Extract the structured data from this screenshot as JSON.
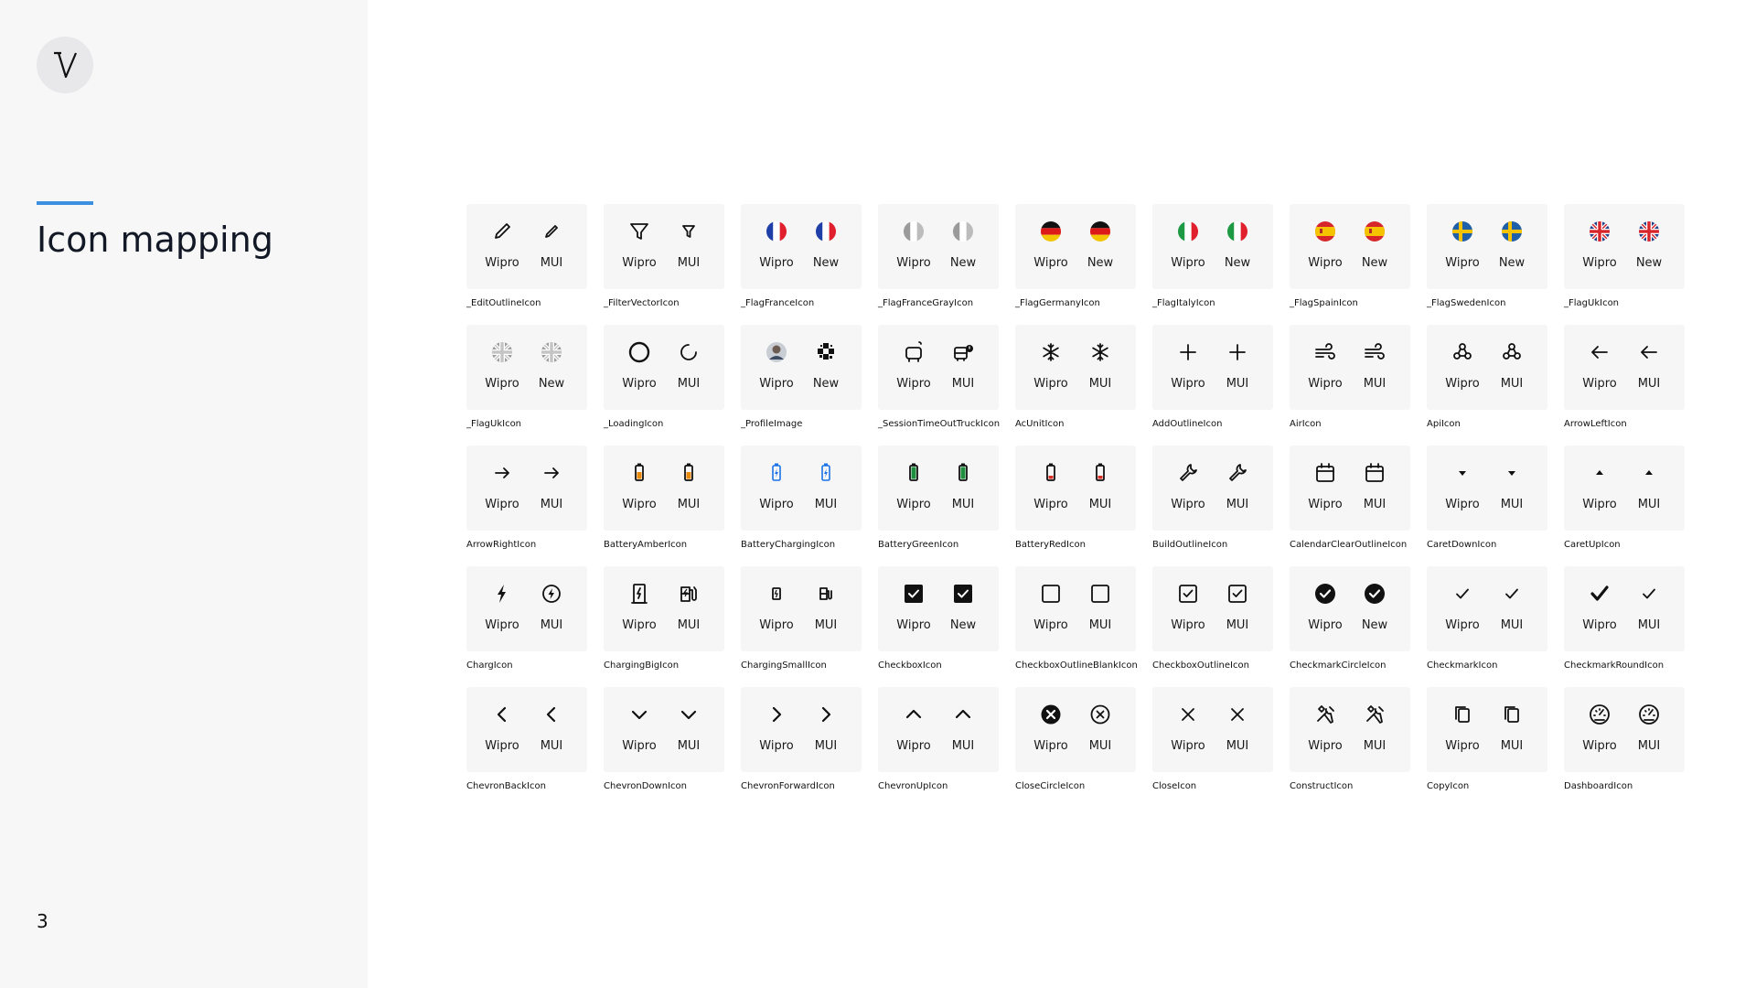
{
  "page": {
    "title": "Icon mapping",
    "number": "3"
  },
  "labels": {
    "wipro": "Wipro",
    "mui": "MUI",
    "new": "New"
  },
  "icons": [
    {
      "name": "_EditOutlineIcon",
      "left": "Wipro",
      "right": "MUI",
      "l_icon": "edit-outline-icon",
      "r_icon": "edit-icon"
    },
    {
      "name": "_FilterVectorIcon",
      "left": "Wipro",
      "right": "MUI",
      "l_icon": "filter-outline-icon",
      "r_icon": "filter-icon"
    },
    {
      "name": "_FlagFranceIcon",
      "left": "Wipro",
      "right": "New",
      "l_icon": "flag-france-icon",
      "r_icon": "flag-france-icon"
    },
    {
      "name": "_FlagFranceGrayIcon",
      "left": "Wipro",
      "right": "New",
      "l_icon": "flag-france-gray-icon",
      "r_icon": "flag-france-gray-icon"
    },
    {
      "name": "_FlagGermanyIcon",
      "left": "Wipro",
      "right": "New",
      "l_icon": "flag-germany-icon",
      "r_icon": "flag-germany-icon"
    },
    {
      "name": "_FlagItalyIcon",
      "left": "Wipro",
      "right": "New",
      "l_icon": "flag-italy-icon",
      "r_icon": "flag-italy-icon"
    },
    {
      "name": "_FlagSpainIcon",
      "left": "Wipro",
      "right": "New",
      "l_icon": "flag-spain-icon",
      "r_icon": "flag-spain-icon"
    },
    {
      "name": "_FlagSwedenIcon",
      "left": "Wipro",
      "right": "New",
      "l_icon": "flag-sweden-icon",
      "r_icon": "flag-sweden-icon"
    },
    {
      "name": "_FlagUkIcon",
      "left": "Wipro",
      "right": "New",
      "l_icon": "flag-uk-icon",
      "r_icon": "flag-uk-icon"
    },
    {
      "name": "_FlagUkIcon",
      "left": "Wipro",
      "right": "New",
      "l_icon": "flag-uk-gray-icon",
      "r_icon": "flag-uk-gray-icon"
    },
    {
      "name": "_LoadingIcon",
      "left": "Wipro",
      "right": "MUI",
      "l_icon": "loading-ring-icon",
      "r_icon": "loading-spinner-icon"
    },
    {
      "name": "_ProfileImage",
      "left": "Wipro",
      "right": "New",
      "l_icon": "profile-photo-icon",
      "r_icon": "profile-pattern-icon"
    },
    {
      "name": "_SessionTimeOutTruckIcon",
      "left": "Wipro",
      "right": "MUI",
      "l_icon": "truck-timeout-icon",
      "r_icon": "bus-alert-icon"
    },
    {
      "name": "AcUnitIcon",
      "left": "Wipro",
      "right": "MUI",
      "l_icon": "snowflake-icon",
      "r_icon": "snowflake-icon"
    },
    {
      "name": "AddOutlineIcon",
      "left": "Wipro",
      "right": "MUI",
      "l_icon": "plus-icon",
      "r_icon": "plus-icon"
    },
    {
      "name": "AirIcon",
      "left": "Wipro",
      "right": "MUI",
      "l_icon": "air-icon",
      "r_icon": "air-icon"
    },
    {
      "name": "ApiIcon",
      "left": "Wipro",
      "right": "MUI",
      "l_icon": "api-icon",
      "r_icon": "api-icon"
    },
    {
      "name": "ArrowLeftIcon",
      "left": "Wipro",
      "right": "MUI",
      "l_icon": "arrow-left-icon",
      "r_icon": "arrow-left-icon"
    },
    {
      "name": "ArrowRightIcon",
      "left": "Wipro",
      "right": "MUI",
      "l_icon": "arrow-right-icon",
      "r_icon": "arrow-right-icon"
    },
    {
      "name": "BatteryAmberIcon",
      "left": "Wipro",
      "right": "MUI",
      "l_icon": "battery-amber-icon",
      "r_icon": "battery-amber-icon"
    },
    {
      "name": "BatteryChargingIcon",
      "left": "Wipro",
      "right": "MUI",
      "l_icon": "battery-charging-icon",
      "r_icon": "battery-charging-icon"
    },
    {
      "name": "BatteryGreenIcon",
      "left": "Wipro",
      "right": "MUI",
      "l_icon": "battery-green-icon",
      "r_icon": "battery-green-icon"
    },
    {
      "name": "BatteryRedIcon",
      "left": "Wipro",
      "right": "MUI",
      "l_icon": "battery-red-icon",
      "r_icon": "battery-red-icon"
    },
    {
      "name": "BuildOutlineIcon",
      "left": "Wipro",
      "right": "MUI",
      "l_icon": "wrench-icon",
      "r_icon": "wrench-icon"
    },
    {
      "name": "CalendarClearOutlineIcon",
      "left": "Wipro",
      "right": "MUI",
      "l_icon": "calendar-icon",
      "r_icon": "calendar-icon"
    },
    {
      "name": "CaretDownIcon",
      "left": "Wipro",
      "right": "MUI",
      "l_icon": "caret-down-icon",
      "r_icon": "caret-down-icon"
    },
    {
      "name": "CaretUpIcon",
      "left": "Wipro",
      "right": "MUI",
      "l_icon": "caret-up-icon",
      "r_icon": "caret-up-icon"
    },
    {
      "name": "ChargIcon",
      "left": "Wipro",
      "right": "MUI",
      "l_icon": "bolt-icon",
      "r_icon": "bolt-circle-icon"
    },
    {
      "name": "ChargingBigIcon",
      "left": "Wipro",
      "right": "MUI",
      "l_icon": "charging-station-icon",
      "r_icon": "ev-station-icon"
    },
    {
      "name": "ChargingSmallIcon",
      "left": "Wipro",
      "right": "MUI",
      "l_icon": "charging-station-small-icon",
      "r_icon": "ev-station-small-icon"
    },
    {
      "name": "CheckboxIcon",
      "left": "Wipro",
      "right": "New",
      "l_icon": "checkbox-checked-icon",
      "r_icon": "checkbox-checked-icon"
    },
    {
      "name": "CheckboxOutlineBlankIcon",
      "left": "Wipro",
      "right": "MUI",
      "l_icon": "checkbox-blank-icon",
      "r_icon": "checkbox-blank-icon"
    },
    {
      "name": "CheckboxOutlineIcon",
      "left": "Wipro",
      "right": "MUI",
      "l_icon": "checkbox-outline-icon",
      "r_icon": "checkbox-outline-icon"
    },
    {
      "name": "CheckmarkCircleIcon",
      "left": "Wipro",
      "right": "New",
      "l_icon": "check-circle-icon",
      "r_icon": "check-circle-icon"
    },
    {
      "name": "CheckmarkIcon",
      "left": "Wipro",
      "right": "MUI",
      "l_icon": "checkmark-icon",
      "r_icon": "checkmark-icon"
    },
    {
      "name": "CheckmarkRoundIcon",
      "left": "Wipro",
      "right": "MUI",
      "l_icon": "checkmark-bold-icon",
      "r_icon": "checkmark-icon"
    },
    {
      "name": "ChevronBackIcon",
      "left": "Wipro",
      "right": "MUI",
      "l_icon": "chevron-left-icon",
      "r_icon": "chevron-left-icon"
    },
    {
      "name": "ChevronDownIcon",
      "left": "Wipro",
      "right": "MUI",
      "l_icon": "chevron-down-icon",
      "r_icon": "chevron-down-icon"
    },
    {
      "name": "ChevronForwardIcon",
      "left": "Wipro",
      "right": "MUI",
      "l_icon": "chevron-right-icon",
      "r_icon": "chevron-right-icon"
    },
    {
      "name": "ChevronUpIcon",
      "left": "Wipro",
      "right": "MUI",
      "l_icon": "chevron-up-icon",
      "r_icon": "chevron-up-icon"
    },
    {
      "name": "CloseCircleIcon",
      "left": "Wipro",
      "right": "MUI",
      "l_icon": "close-circle-filled-icon",
      "r_icon": "close-circle-outline-icon"
    },
    {
      "name": "CloseIcon",
      "left": "Wipro",
      "right": "MUI",
      "l_icon": "close-icon",
      "r_icon": "close-icon"
    },
    {
      "name": "ConstructIcon",
      "left": "Wipro",
      "right": "MUI",
      "l_icon": "construct-icon",
      "r_icon": "construct-icon"
    },
    {
      "name": "CopyIcon",
      "left": "Wipro",
      "right": "MUI",
      "l_icon": "copy-icon",
      "r_icon": "copy-icon"
    },
    {
      "name": "DashboardIcon",
      "left": "Wipro",
      "right": "MUI",
      "l_icon": "dashboard-gauge-icon",
      "r_icon": "dashboard-gauge-icon"
    }
  ]
}
